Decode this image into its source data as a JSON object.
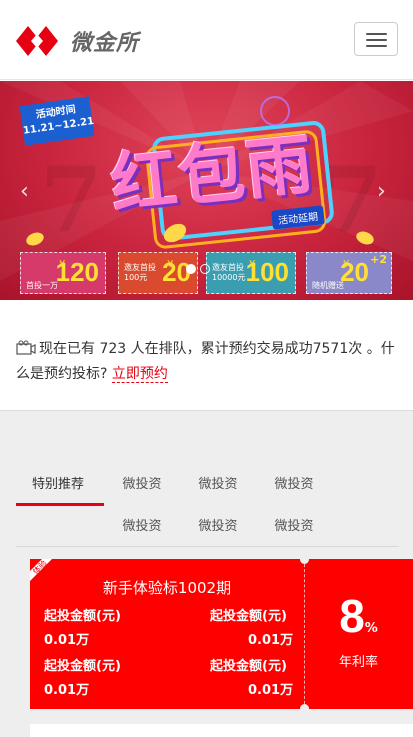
{
  "header": {
    "logo_text": "微金所",
    "colors": {
      "brand": "#e60012"
    }
  },
  "banner": {
    "date_label": "活动时间",
    "date_range": "11.21~12.21",
    "title": "红包雨",
    "delay_label": "活动延期",
    "cards": [
      {
        "label": "首投一万",
        "value": "120",
        "currency": "¥"
      },
      {
        "label": "邀友首投 100元",
        "value": "20",
        "currency": "¥"
      },
      {
        "label": "邀友首投 10000元",
        "value": "100",
        "currency": "¥"
      },
      {
        "label": "随机赠送",
        "value": "20",
        "sup": "+2",
        "currency": "¥"
      }
    ],
    "active_slide": 1,
    "slide_count": 2
  },
  "notice": {
    "text": "现在已有 723 人在排队，累计预约交易成功7571次 。什么是预约投标?",
    "link": "立即预约"
  },
  "tabs": {
    "items": [
      "特别推荐",
      "微投资",
      "微投资",
      "微投资",
      "微投资",
      "微投资",
      "微投资"
    ],
    "active": 0
  },
  "product": {
    "badge": "体验",
    "title": "新手体验标1002期",
    "fields": [
      {
        "label": "起投金额(元)",
        "value": "0.01万"
      },
      {
        "label": "起投金额(元)",
        "value": "0.01万"
      },
      {
        "label": "起投金额(元)",
        "value": "0.01万"
      },
      {
        "label": "起投金额(元)",
        "value": "0.01万"
      }
    ],
    "rate_value": "8",
    "rate_unit": "%",
    "rate_label": "年利率"
  }
}
